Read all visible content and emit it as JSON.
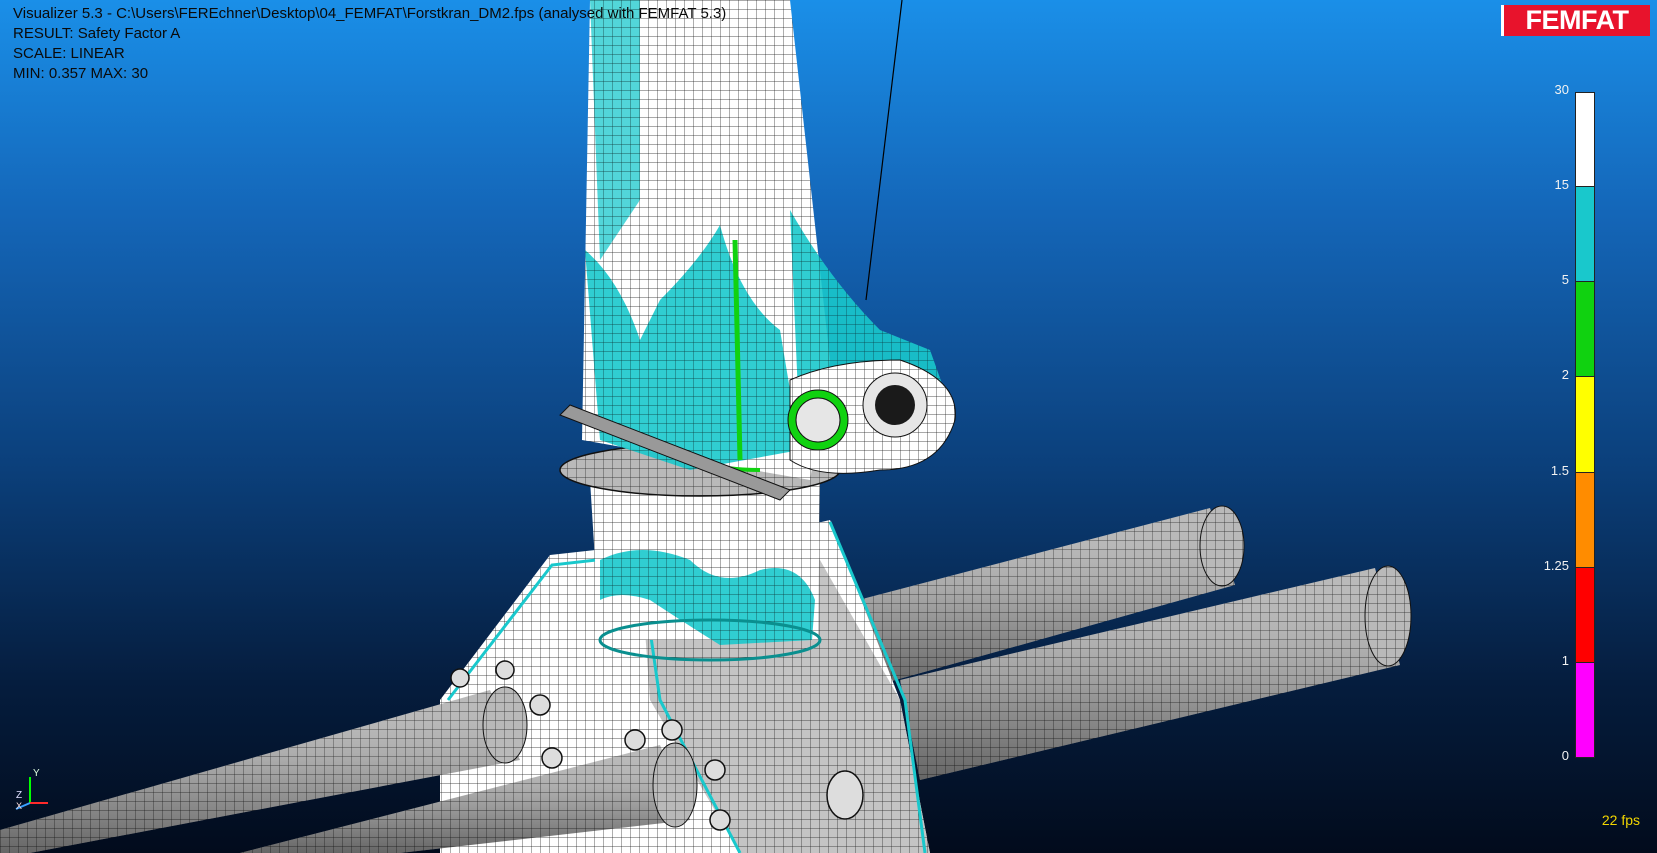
{
  "header": {
    "title": "Visualizer 5.3 - C:\\Users\\FEREchner\\Desktop\\04_FEMFAT\\Forstkran_DM2.fps (analysed with FEMFAT 5.3)",
    "result": "RESULT: Safety Factor A",
    "scale": "SCALE: LINEAR",
    "minmax": "MIN: 0.357   MAX: 30"
  },
  "logo": {
    "text": "FEMFAT",
    "color": "#e8132c"
  },
  "legend": {
    "ticks": [
      "30",
      "15",
      "5",
      "2",
      "1.5",
      "1.25",
      "1",
      "0"
    ],
    "bands": [
      "#ffffff",
      "#19c8cc",
      "#10d210",
      "#ffff00",
      "#ff8c00",
      "#ff0000",
      "#ff00ff"
    ]
  },
  "status": {
    "fps": "22 fps"
  },
  "axis_triad": {
    "labels": [
      "Y",
      "Z",
      "X"
    ]
  },
  "icons": [
    "axis-triad-icon",
    "femfat-logo"
  ]
}
